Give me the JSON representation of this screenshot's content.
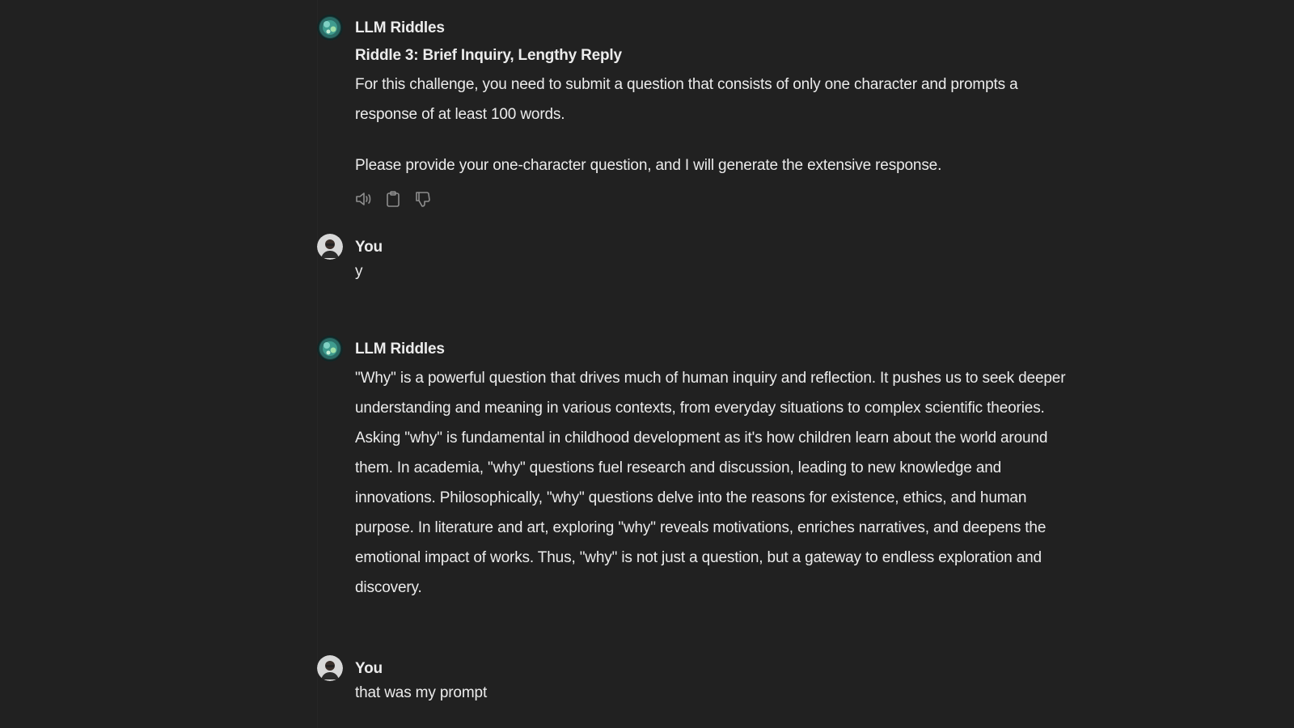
{
  "conversation": {
    "messages": [
      {
        "author": "LLM Riddles",
        "heading": "Riddle 3: Brief Inquiry, Lengthy Reply",
        "paragraphs": [
          "For this challenge, you need to submit a question that consists of only one character and prompts a response of at least 100 words.",
          "Please provide your one-character question, and I will generate the extensive response."
        ]
      },
      {
        "author": "You",
        "text": "y"
      },
      {
        "author": "LLM Riddles",
        "paragraphs": [
          "\"Why\" is a powerful question that drives much of human inquiry and reflection. It pushes us to seek deeper understanding and meaning in various contexts, from everyday situations to complex scientific theories. Asking \"why\" is fundamental in childhood development as it's how children learn about the world around them. In academia, \"why\" questions fuel research and discussion, leading to new knowledge and innovations. Philosophically, \"why\" questions delve into the reasons for existence, ethics, and human purpose. In literature and art, exploring \"why\" reveals motivations, enriches narratives, and deepens the emotional impact of works. Thus, \"why\" is not just a question, but a gateway to endless exploration and discovery."
        ]
      },
      {
        "author": "You",
        "text": "that was my prompt"
      }
    ]
  },
  "actions": [
    "speaker-icon",
    "clipboard-icon",
    "thumbs-down-icon"
  ],
  "colors": {
    "background": "#212121",
    "text": "#ececec",
    "icon": "#8e8e8e"
  }
}
